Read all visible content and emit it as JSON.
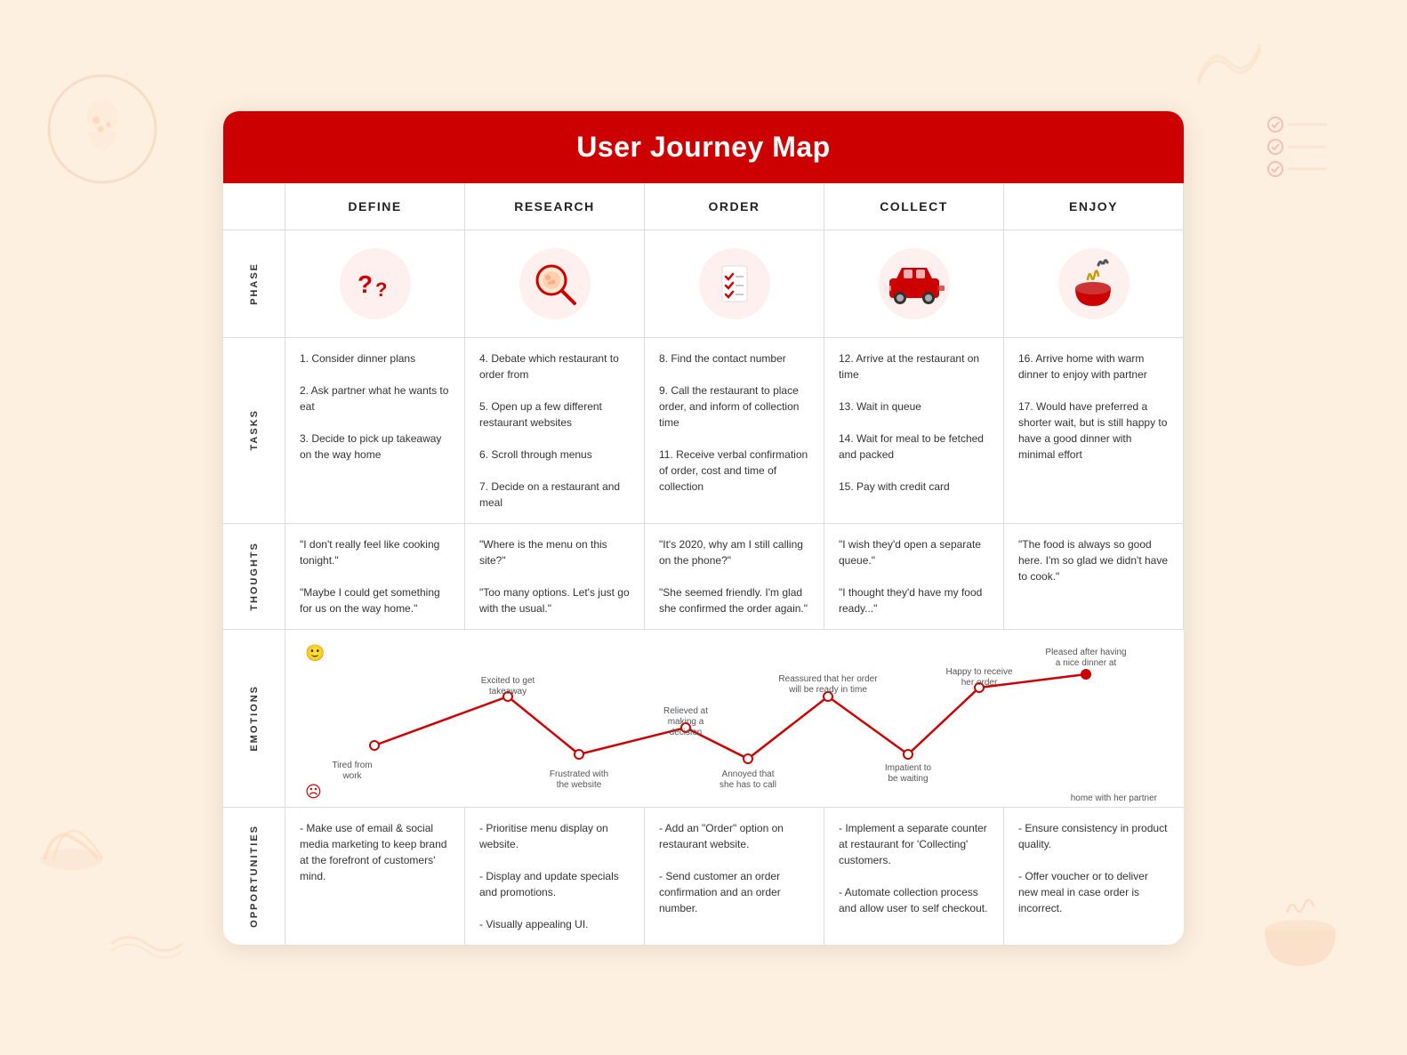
{
  "title": "User Journey Map",
  "phases": [
    "DEFINE",
    "RESEARCH",
    "ORDER",
    "COLLECT",
    "ENJOY"
  ],
  "rows": {
    "phase": "PHASE",
    "tasks": "TASKS",
    "thoughts": "THOUGHTS",
    "emotions": "EMOTIONS",
    "opportunities": "OPPORTUNITIES"
  },
  "tasks": [
    "1. Consider dinner plans\n\n2. Ask partner what he wants to eat\n\n3. Decide to pick up takeaway on the way home",
    "4. Debate which restaurant to order from\n\n5. Open up a few different restaurant websites\n\n6. Scroll through menus\n\n7. Decide on a restaurant and meal",
    "8. Find the contact number\n\n9. Call the restaurant to place order, and inform of collection time\n\n11. Receive verbal confirmation of order, cost and time of collection",
    "12. Arrive at the restaurant on time\n\n13. Wait in queue\n\n14. Wait for meal to be fetched and packed\n\n15. Pay with credit card",
    "16. Arrive home with warm dinner to enjoy with partner\n\n17. Would have preferred a shorter wait, but is still happy to have a good dinner with minimal effort"
  ],
  "thoughts": [
    "\"I don't really feel like cooking tonight.\"\n\n\"Maybe I could get something for us on the way home.\"",
    "\"Where is the menu on this site?\"\n\n\"Too many options. Let's just go with the usual.\"",
    "\"It's 2020, why am I still calling on the phone?\"\n\n\"She seemed friendly. I'm glad she confirmed the order again.\"",
    "\"I wish they'd open a separate queue.\"\n\n\"I thought they'd have my food ready...\"",
    "\"The food is always so good here. I'm so glad we didn't have to cook.\""
  ],
  "opportunities": [
    "- Make use of email & social media marketing to keep brand at the forefront of customers' mind.",
    "- Prioritise menu display on website.\n\n- Display and update specials and promotions.\n\n- Visually appealing UI.",
    "- Add an \"Order\" option on restaurant website.\n\n- Send customer an order confirmation and an order number.",
    "- Implement a separate counter at restaurant for 'Collecting' customers.\n\n- Automate collection process and allow user to self checkout.",
    "- Ensure consistency in product quality.\n\n- Offer voucher or to deliver new meal in case order is incorrect."
  ],
  "emotion_labels": {
    "high_smile": "😊",
    "low_frown": "☹️",
    "tired": "Tired from work",
    "excited": "Excited to get takeaway",
    "frustrated": "Frustrated with the website",
    "relieved": "Relieved at making a decision",
    "annoyed": "Annoyed that she has to call",
    "reassured": "Reassured that her order will be ready in time",
    "impatient": "Impatient to be waiting",
    "happy": "Happy to receive her order",
    "pleased": "Pleased after having a nice dinner at home with her partner"
  }
}
